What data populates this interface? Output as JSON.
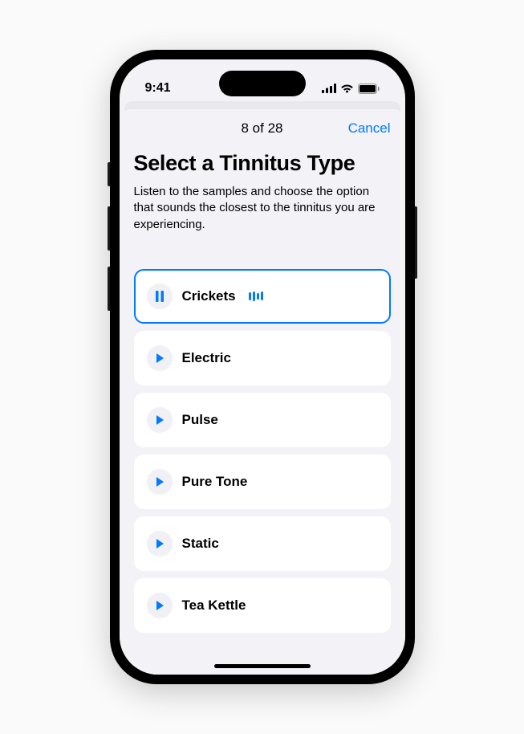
{
  "status": {
    "time": "9:41"
  },
  "nav": {
    "progress": "8 of 28",
    "cancel": "Cancel"
  },
  "header": {
    "title": "Select a Tinnitus Type",
    "subtitle": "Listen to the samples and choose the option that sounds the closest to the tinnitus you are experiencing."
  },
  "options": [
    {
      "label": "Crickets",
      "playing": true
    },
    {
      "label": "Electric",
      "playing": false
    },
    {
      "label": "Pulse",
      "playing": false
    },
    {
      "label": "Pure Tone",
      "playing": false
    },
    {
      "label": "Static",
      "playing": false
    },
    {
      "label": "Tea Kettle",
      "playing": false
    }
  ],
  "colors": {
    "accent": "#007aff",
    "background": "#f2f2f7",
    "card": "#ffffff"
  }
}
